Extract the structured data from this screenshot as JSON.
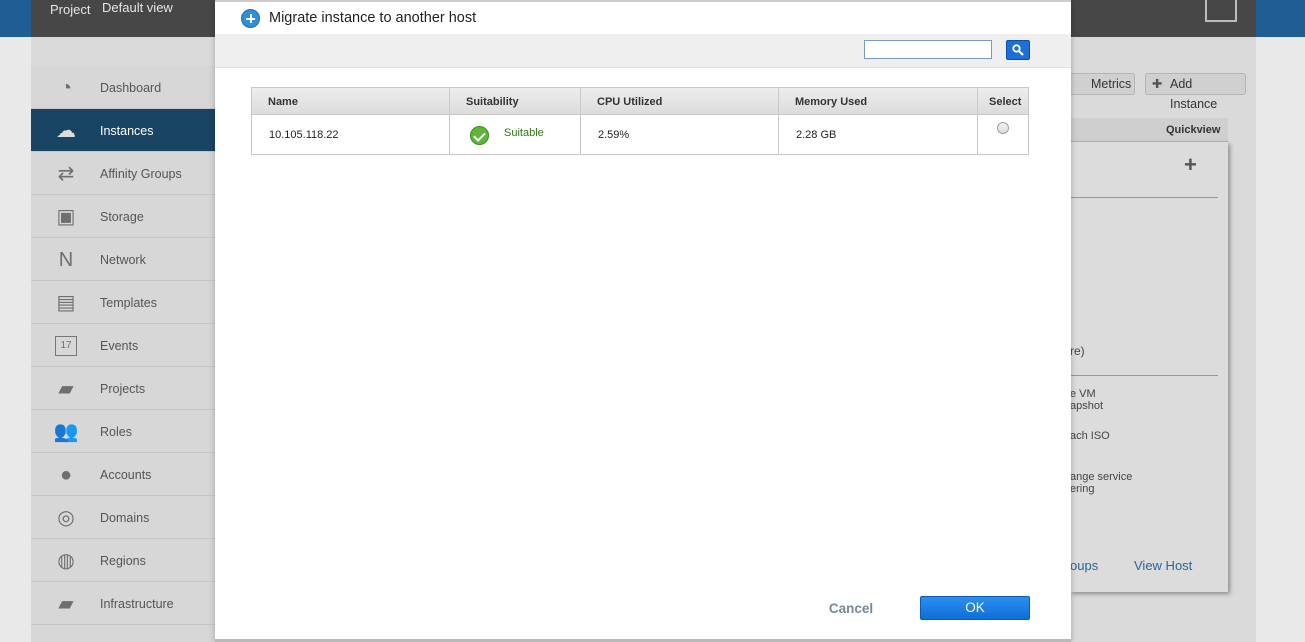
{
  "header": {
    "project_label": "Project",
    "view_label": "Default view"
  },
  "sidebar": {
    "items": [
      {
        "label": "Dashboard",
        "icon": "dashboard-icon"
      },
      {
        "label": "Instances",
        "icon": "cloud-icon",
        "active": true
      },
      {
        "label": "Affinity Groups",
        "icon": "affinity-icon"
      },
      {
        "label": "Storage",
        "icon": "storage-icon"
      },
      {
        "label": "Network",
        "icon": "network-icon"
      },
      {
        "label": "Templates",
        "icon": "templates-icon"
      },
      {
        "label": "Events",
        "icon": "calendar-icon",
        "badge": "17"
      },
      {
        "label": "Projects",
        "icon": "folder-icon"
      },
      {
        "label": "Roles",
        "icon": "roles-icon"
      },
      {
        "label": "Accounts",
        "icon": "user-icon"
      },
      {
        "label": "Domains",
        "icon": "domains-icon"
      },
      {
        "label": "Regions",
        "icon": "globe-icon"
      },
      {
        "label": "Infrastructure",
        "icon": "infrastructure-icon"
      }
    ]
  },
  "toolbar": {
    "metrics_label": "Metrics",
    "add_instance_label": "Add Instance"
  },
  "quickview": {
    "header_label": "Quickview",
    "plus_symbol": "+",
    "texts": [
      "re)",
      "e VM",
      "apshot",
      "ach ISO",
      "ange service",
      "ering"
    ],
    "link_left": "oups",
    "link_right": "View Host"
  },
  "dialog": {
    "title": "Migrate instance to another host",
    "search": {
      "value": "",
      "placeholder": ""
    },
    "columns": [
      "Name",
      "Suitability",
      "CPU Utilized",
      "Memory Used",
      "Select"
    ],
    "rows": [
      {
        "name": "10.105.118.22",
        "suitability": "Suitable",
        "cpu": "2.59%",
        "memory": "2.28 GB",
        "selected": false
      }
    ],
    "cancel_label": "Cancel",
    "ok_label": "OK"
  },
  "colors": {
    "primary_button": "#1a75e0",
    "suitable_green": "#5fb537",
    "active_nav": "#1a4464",
    "topbar_blue": "#1f5d92"
  }
}
